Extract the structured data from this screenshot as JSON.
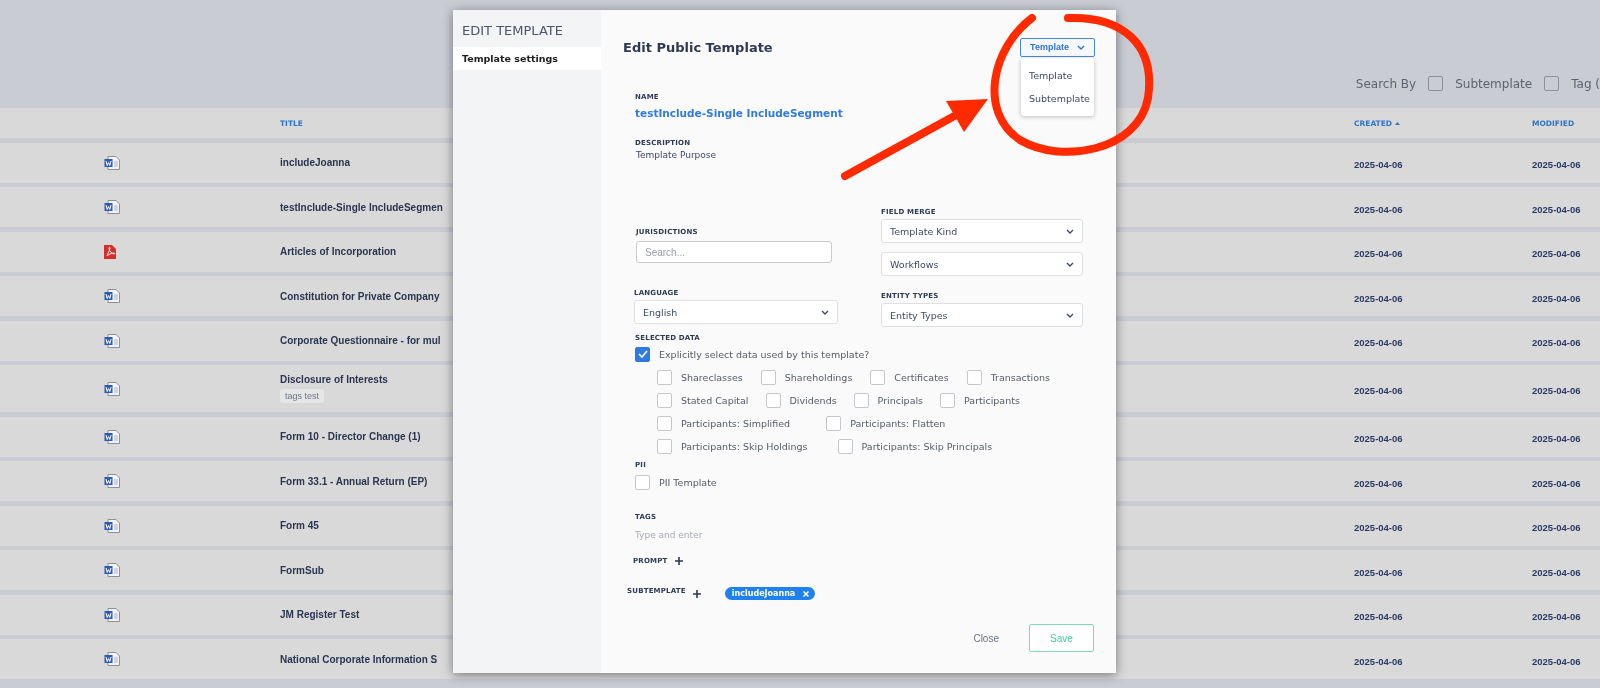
{
  "background": {
    "search_by": {
      "label": "Search By",
      "options": [
        {
          "label": "Subtemplate",
          "checked": false
        },
        {
          "label": "Tag (",
          "checked": false
        }
      ]
    },
    "table": {
      "columns": [
        {
          "label": "TITLE",
          "sorted": false
        },
        {
          "label": "CREATED",
          "sorted": true
        },
        {
          "label": "MODIFIED",
          "sorted": false
        }
      ],
      "rows": [
        {
          "kind": "word",
          "title": "includeJoanna",
          "created": "2025-04-06",
          "modified": "2025-04-06"
        },
        {
          "kind": "word",
          "title": "testInclude-Single IncludeSegmen",
          "created": "2025-04-06",
          "modified": "2025-04-06"
        },
        {
          "kind": "pdf",
          "title": "Articles of Incorporation",
          "created": "2025-04-06",
          "modified": "2025-04-06"
        },
        {
          "kind": "word",
          "title": "Constitution for Private Company",
          "created": "2025-04-06",
          "modified": "2025-04-06"
        },
        {
          "kind": "word",
          "title": "Corporate Questionnaire - for mul",
          "created": "2025-04-06",
          "modified": "2025-04-06"
        },
        {
          "kind": "word",
          "title": "Disclosure of Interests",
          "tags": [
            "tags test"
          ],
          "created": "2025-04-06",
          "modified": "2025-04-06"
        },
        {
          "kind": "word",
          "title": "Form 10 - Director Change (1)",
          "created": "2025-04-06",
          "modified": "2025-04-06"
        },
        {
          "kind": "word",
          "title": "Form 33.1 - Annual Return (EP)",
          "created": "2025-04-06",
          "modified": "2025-04-06"
        },
        {
          "kind": "word",
          "title": "Form 45",
          "created": "2025-04-06",
          "modified": "2025-04-06"
        },
        {
          "kind": "word",
          "title": "FormSub",
          "created": "2025-04-06",
          "modified": "2025-04-06"
        },
        {
          "kind": "word",
          "title": "JM Register Test",
          "created": "2025-04-06",
          "modified": "2025-04-06"
        },
        {
          "kind": "word",
          "title": "National Corporate Information S",
          "created": "2025-04-06",
          "modified": "2025-04-06"
        }
      ]
    }
  },
  "modal": {
    "sidebar": {
      "title": "EDIT TEMPLATE",
      "items": [
        {
          "label": "Template settings",
          "selected": true
        }
      ]
    },
    "title": "Edit Public Template",
    "type_dropdown": {
      "value": "Template",
      "expanded": true,
      "options": [
        "Template",
        "Subtemplate"
      ]
    },
    "name": {
      "label": "NAME",
      "value": "testInclude-Single IncludeSegment"
    },
    "description": {
      "label": "DESCRIPTION",
      "value": "Template Purpose"
    },
    "jurisdictions": {
      "label": "JURISDICTIONS",
      "placeholder": "Search..."
    },
    "field_merge": {
      "label": "FIELD MERGE",
      "selects": [
        "Template Kind",
        "Workflows"
      ]
    },
    "language": {
      "label": "LANGUAGE",
      "value": "English"
    },
    "entity_types": {
      "label": "ENTITY TYPES",
      "value": "Entity Types"
    },
    "selected_data": {
      "label": "SELECTED DATA",
      "explicit": {
        "label": "Explicitly select data used by this template?",
        "checked": true
      },
      "option_rows": [
        [
          {
            "label": "Shareclasses",
            "checked": false
          },
          {
            "label": "Shareholdings",
            "checked": false
          },
          {
            "label": "Certificates",
            "checked": false
          },
          {
            "label": "Transactions",
            "checked": false
          }
        ],
        [
          {
            "label": "Stated Capital",
            "checked": false
          },
          {
            "label": "Dividends",
            "checked": false
          },
          {
            "label": "Principals",
            "checked": false
          },
          {
            "label": "Participants",
            "checked": false
          }
        ],
        [
          {
            "label": "Participants: Simplified",
            "checked": false
          },
          {
            "label": "Participants: Flatten",
            "checked": false
          }
        ],
        [
          {
            "label": "Participants: Skip Holdings",
            "checked": false
          },
          {
            "label": "Participants: Skip Principals",
            "checked": false
          }
        ]
      ]
    },
    "pii": {
      "label": "PII",
      "option": {
        "label": "PII Template",
        "checked": false
      }
    },
    "tags": {
      "label": "TAGS",
      "placeholder": "Type and enter"
    },
    "prompt": {
      "label": "PROMPT"
    },
    "subtemplate": {
      "label": "SUBTEMPLATE",
      "chips": [
        "includeJoanna"
      ]
    },
    "buttons": {
      "close": "Close",
      "save": "Save"
    }
  }
}
